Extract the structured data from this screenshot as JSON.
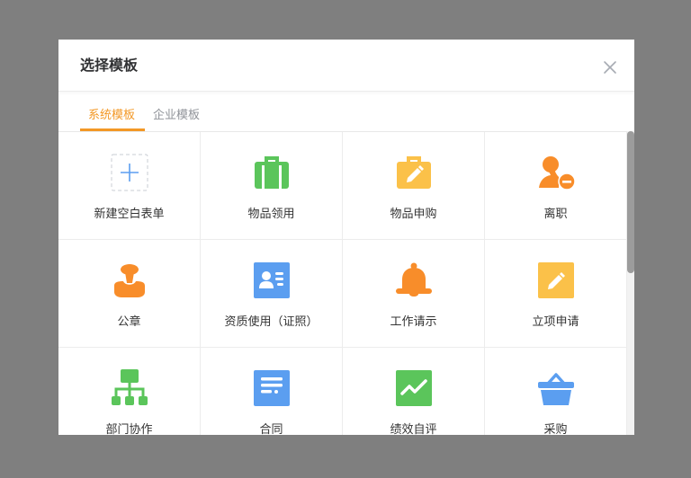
{
  "modal": {
    "title": "选择模板",
    "close_icon": "close-icon"
  },
  "tabs": [
    {
      "label": "系统模板",
      "active": true
    },
    {
      "label": "企业模板",
      "active": false
    }
  ],
  "templates": [
    {
      "label": "新建空白表单",
      "icon": "plus-icon",
      "color": "#5b9ef0"
    },
    {
      "label": "物品领用",
      "icon": "briefcase-icon",
      "color": "#5bc55b"
    },
    {
      "label": "物品申购",
      "icon": "bag-edit-icon",
      "color": "#fbc149"
    },
    {
      "label": "离职",
      "icon": "user-remove-icon",
      "color": "#f88d2a"
    },
    {
      "label": "公章",
      "icon": "stamp-icon",
      "color": "#f88d2a"
    },
    {
      "label": "资质使用（证照）",
      "icon": "id-card-icon",
      "color": "#5b9ef0"
    },
    {
      "label": "工作请示",
      "icon": "bell-icon",
      "color": "#f88d2a"
    },
    {
      "label": "立项申请",
      "icon": "edit-icon",
      "color": "#fbc149"
    },
    {
      "label": "部门协作",
      "icon": "org-chart-icon",
      "color": "#5bc55b"
    },
    {
      "label": "合同",
      "icon": "document-icon",
      "color": "#5b9ef0"
    },
    {
      "label": "绩效自评",
      "icon": "trend-chart-icon",
      "color": "#5bc55b"
    },
    {
      "label": "采购",
      "icon": "basket-icon",
      "color": "#5b9ef0"
    }
  ],
  "colors": {
    "accent": "#f39826",
    "overlay": "#7f7f7f",
    "blue": "#5b9ef0",
    "green": "#5bc55b",
    "yellow": "#fbc149",
    "orange": "#f88d2a"
  }
}
